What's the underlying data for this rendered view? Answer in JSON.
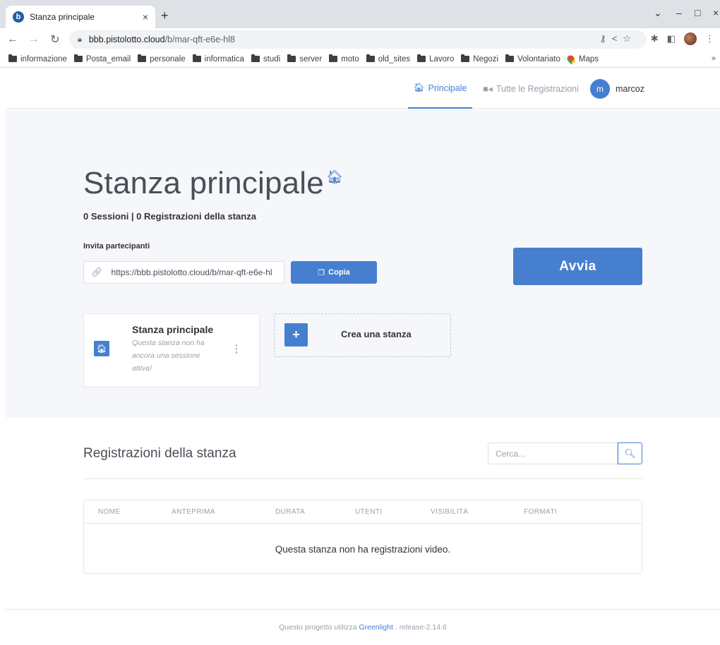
{
  "browser": {
    "tab_title": "Stanza principale",
    "tab_close": "×",
    "new_tab": "+",
    "favicon_letter": "b",
    "url_host": "bbb.pistolotto.cloud",
    "url_path": "/b/mar-qft-e6e-hl8",
    "bookmarks": [
      "informazione",
      "Posta_email",
      "personale",
      "informatica",
      "studi",
      "server",
      "moto",
      "old_sites",
      "Lavoro",
      "Negozi",
      "Volontariato"
    ],
    "maps_bookmark": "Maps",
    "more_bookmarks": "»"
  },
  "nav": {
    "principale": "Principale",
    "registrazioni": "Tutte le Registrazioni",
    "avatar_letter": "m",
    "username": "marcoz"
  },
  "room": {
    "title": "Stanza principale",
    "stats": "0 Sessioni | 0 Registrazioni della stanza",
    "invite_label": "Invita partecipanti",
    "invite_url": "https://bbb.pistolotto.cloud/b/mar-qft-e6e-hl",
    "copy_label": "Copia",
    "start_label": "Avvia"
  },
  "cards": {
    "room_name": "Stanza principale",
    "room_desc": "Questa stanza non ha ancora una sessione attiva!",
    "create_label": "Crea una stanza"
  },
  "recordings": {
    "title": "Registrazioni della stanza",
    "search_placeholder": "Cerca...",
    "columns": [
      "NOME",
      "ANTEPRIMA",
      "DURATA",
      "UTENTI",
      "VISIBILITÀ",
      "FORMATI"
    ],
    "empty_message": "Questa stanza non ha registrazioni video."
  },
  "footer": {
    "prefix": "Questo progetto utilizza",
    "link": "Greenlight",
    "suffix": ". release-2.14.6"
  },
  "colors": {
    "accent": "#467fcf",
    "hero_bg": "#f5f7fb"
  }
}
